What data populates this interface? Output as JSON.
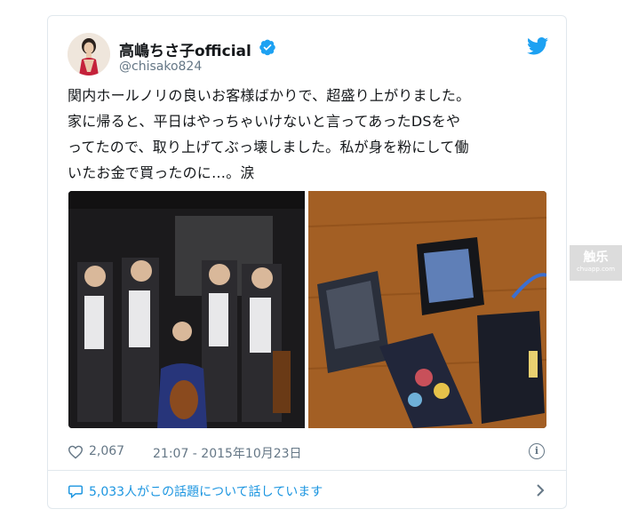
{
  "tweet": {
    "display_name": "高嶋ちさ子official",
    "handle": "@chisako824",
    "text_lines": [
      "関内ホールノリの良いお客様ばかりで、超盛り上がりました。",
      "家に帰ると、平日はやっちゃいけないと言ってあったDSをや",
      "ってたので、取り上げてぶっ壊しました。私が身を粉にして働",
      "いたお金で買ったのに…。涙"
    ],
    "like_count": "2,067",
    "timestamp": "21:07 - 2015年10月23日",
    "footer_text": "5,033人がこの話題について話しています"
  },
  "icons": {
    "verified": "verified-badge-icon",
    "bird": "twitter-bird-icon",
    "heart": "heart-icon",
    "info": "info-icon",
    "comment": "comment-icon",
    "chevron": "chevron-right-icon"
  },
  "colors": {
    "twitter_blue": "#1da1f2",
    "link_blue": "#1b95e0",
    "muted": "#657786"
  },
  "watermark": {
    "main": "触乐",
    "sub": "chuapp.com"
  }
}
